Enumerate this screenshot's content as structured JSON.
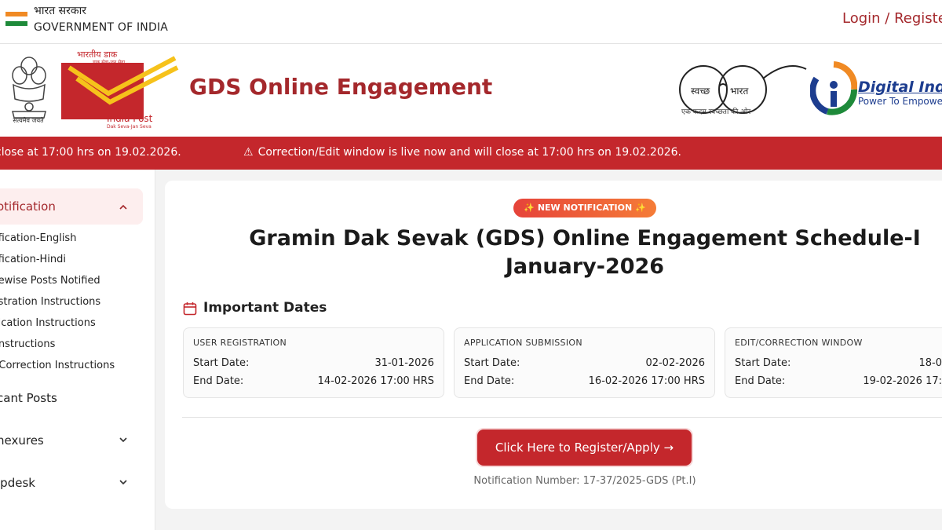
{
  "gov": {
    "hindi": "भारत सरकार",
    "english": "GOVERNMENT OF INDIA",
    "login": "Login / Registe"
  },
  "header": {
    "emblem_caption": "सत्यमेव जयते",
    "indiapost_hi": "भारतीय डाक",
    "indiapost_tag_hi": "डाक सेवा-जन सेवा",
    "indiapost_en": "India Post",
    "indiapost_tag_en": "Dak Seva-Jan Seva",
    "title": "GDS Online Engagement",
    "swachh_left": "स्वच्छ",
    "swachh_right": "भारत",
    "swachh_caption": "एक कदम स्वच्छता की ओर",
    "digital_india": "Digital Indi",
    "digital_india_sub": "Power To Empowe"
  },
  "ticker": {
    "msg1": "close at 17:00 hrs on 19.02.2026.",
    "msg2": "Correction/Edit window is live now and will close at 17:00 hrs on 19.02.2026.",
    "warn_icon": "⚠"
  },
  "sidebar": {
    "active_label": "otification",
    "sub_items": [
      "ification-English",
      "ification-Hindi",
      "lewise Posts Notified",
      "istration Instructions",
      "lication Instructions",
      " Instructions",
      "/Correction Instructions"
    ],
    "items": [
      "cant Posts",
      "nexures",
      "lpdesk"
    ]
  },
  "main": {
    "badge": "✨ NEW NOTIFICATION ✨",
    "title_line1": "Gramin Dak Sevak (GDS) Online Engagement Schedule-I",
    "title_line2": "January-2026",
    "dates_heading": "Important Dates",
    "date_cards": [
      {
        "heading": "USER REGISTRATION",
        "start_label": "Start Date:",
        "start": "31-01-2026",
        "end_label": "End Date:",
        "end": "14-02-2026 17:00 HRS"
      },
      {
        "heading": "APPLICATION SUBMISSION",
        "start_label": "Start Date:",
        "start": "02-02-2026",
        "end_label": "End Date:",
        "end": "16-02-2026 17:00 HRS"
      },
      {
        "heading": "EDIT/CORRECTION WINDOW",
        "start_label": "Start Date:",
        "start": "18-0",
        "end_label": "End Date:",
        "end": "19-02-2026 17:"
      }
    ],
    "cta": "Click Here to Register/Apply →",
    "notification_number": "Notification Number: 17-37/2025-GDS (Pt.I)"
  },
  "colors": {
    "brand": "#c4272c",
    "title": "#a4282c",
    "digital": "#1d3d8f"
  }
}
